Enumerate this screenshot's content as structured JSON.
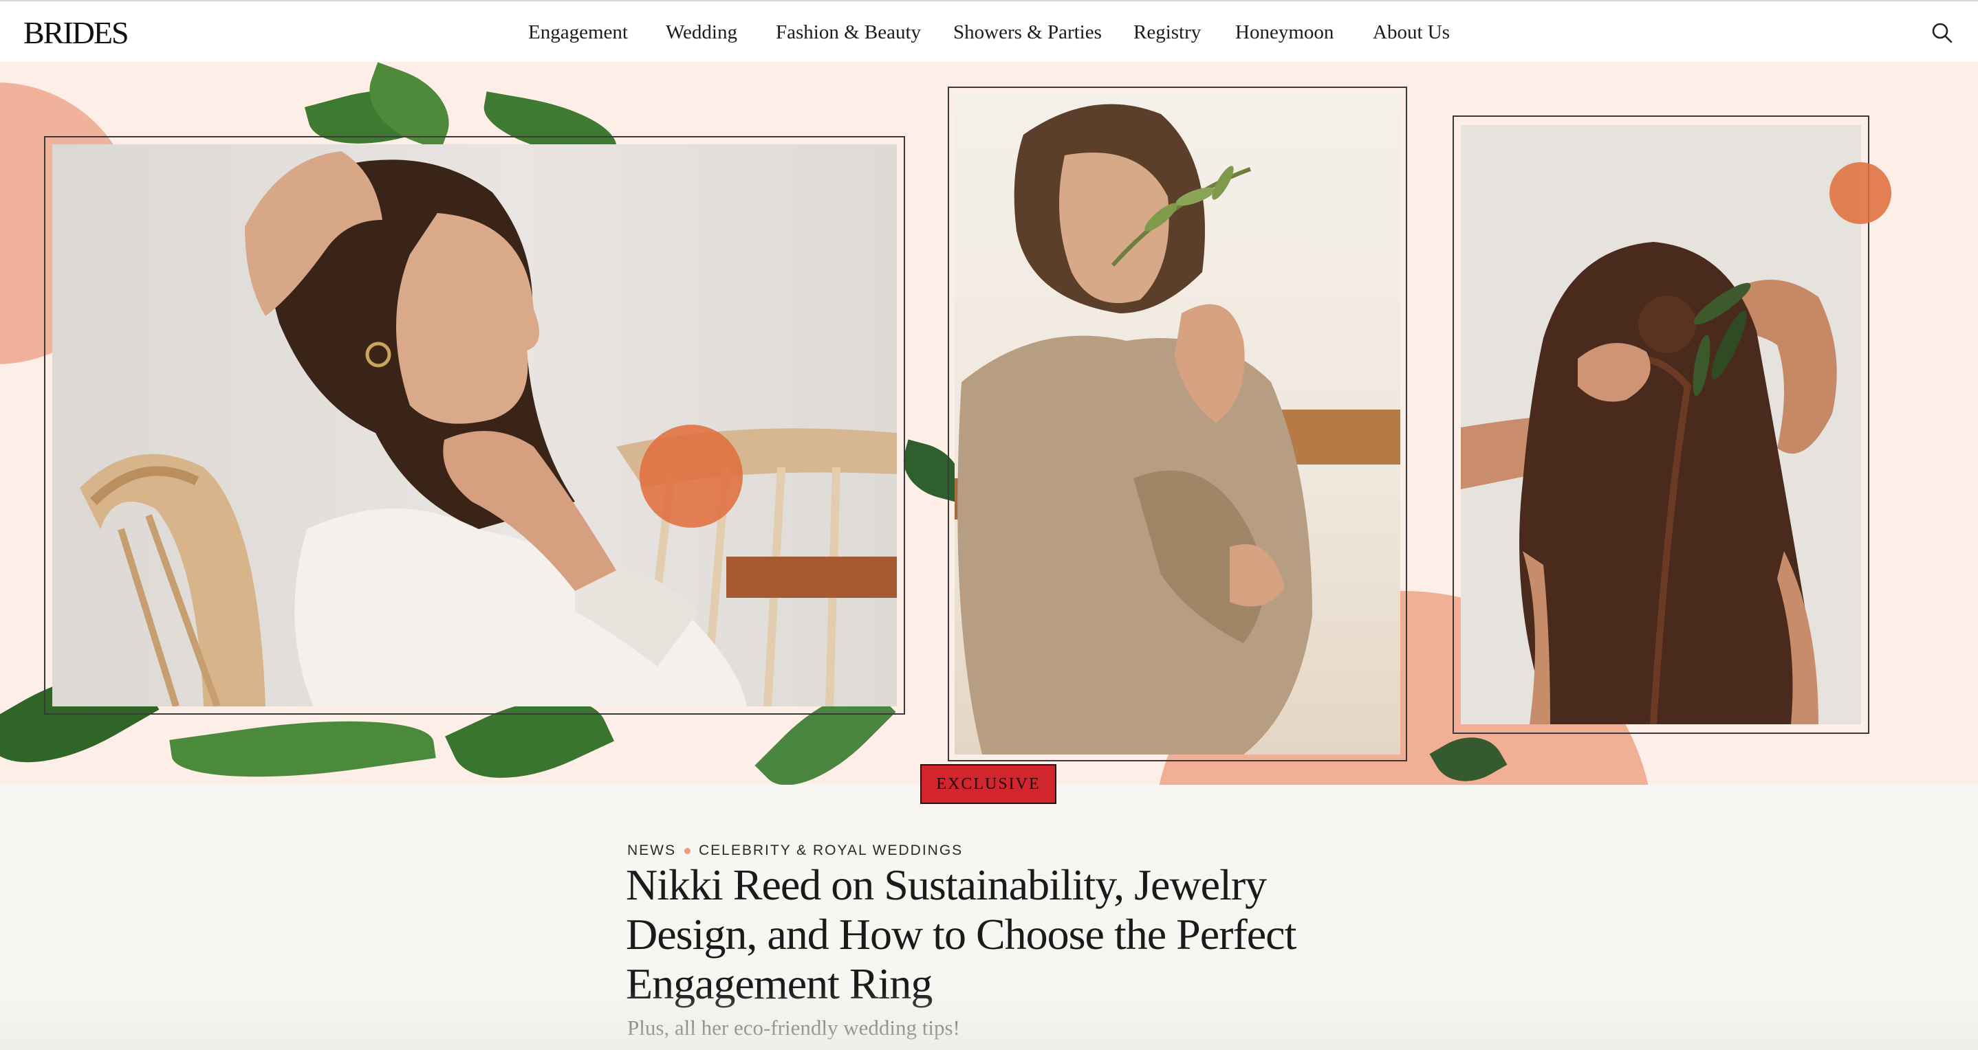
{
  "header": {
    "logo": "BRIDES",
    "nav": [
      {
        "label": "Engagement"
      },
      {
        "label": "Wedding"
      },
      {
        "label": "Fashion & Beauty"
      },
      {
        "label": "Showers & Parties"
      },
      {
        "label": "Registry"
      },
      {
        "label": "Honeymoon"
      },
      {
        "label": "About Us"
      }
    ],
    "search_icon": "search-icon"
  },
  "hero": {
    "badge": "EXCLUSIVE",
    "accent_color": "#e0703f",
    "blush_color": "#fdeee8",
    "photos": [
      "left-portrait",
      "center-portrait",
      "right-portrait"
    ]
  },
  "article": {
    "category_primary": "NEWS",
    "category_secondary": "CELEBRITY & ROYAL WEDDINGS",
    "headline": "Nikki Reed on Sustainability, Jewelry Design, and How to Choose the Perfect Engagement Ring",
    "dek": "Plus, all her eco-friendly wedding tips!"
  }
}
